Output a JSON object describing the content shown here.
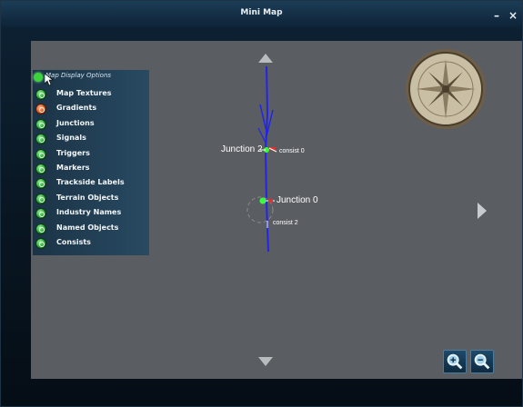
{
  "window": {
    "title": "Mini Map",
    "minimize_glyph": "–",
    "close_glyph": "×"
  },
  "options": {
    "header": "Map Display Options",
    "items": [
      {
        "label": "Map Textures",
        "enabled": true
      },
      {
        "label": "Gradients",
        "enabled": false
      },
      {
        "label": "Junctions",
        "enabled": true
      },
      {
        "label": "Signals",
        "enabled": true
      },
      {
        "label": "Triggers",
        "enabled": true
      },
      {
        "label": "Markers",
        "enabled": true
      },
      {
        "label": "Trackside Labels",
        "enabled": true
      },
      {
        "label": "Terrain Objects",
        "enabled": true
      },
      {
        "label": "Industry Names",
        "enabled": true
      },
      {
        "label": "Named Objects",
        "enabled": true
      },
      {
        "label": "Consists",
        "enabled": true
      }
    ]
  },
  "map": {
    "labels": {
      "junction_2": "Junction 2",
      "junction_0": "Junction 0",
      "consist_0": "consist 0",
      "consist_2": "consist 2"
    }
  },
  "colors": {
    "track": "#2424e8",
    "junction_green": "#3cff3c",
    "consist_red": "#e03030",
    "map_bg": "#5a5e63"
  },
  "icons": {
    "nav_up": "triangle-up-icon",
    "nav_down": "triangle-down-icon",
    "nav_right": "triangle-right-icon",
    "compass": "compass-icon",
    "zoom_in": "zoom-in-icon",
    "zoom_out": "zoom-out-icon"
  }
}
